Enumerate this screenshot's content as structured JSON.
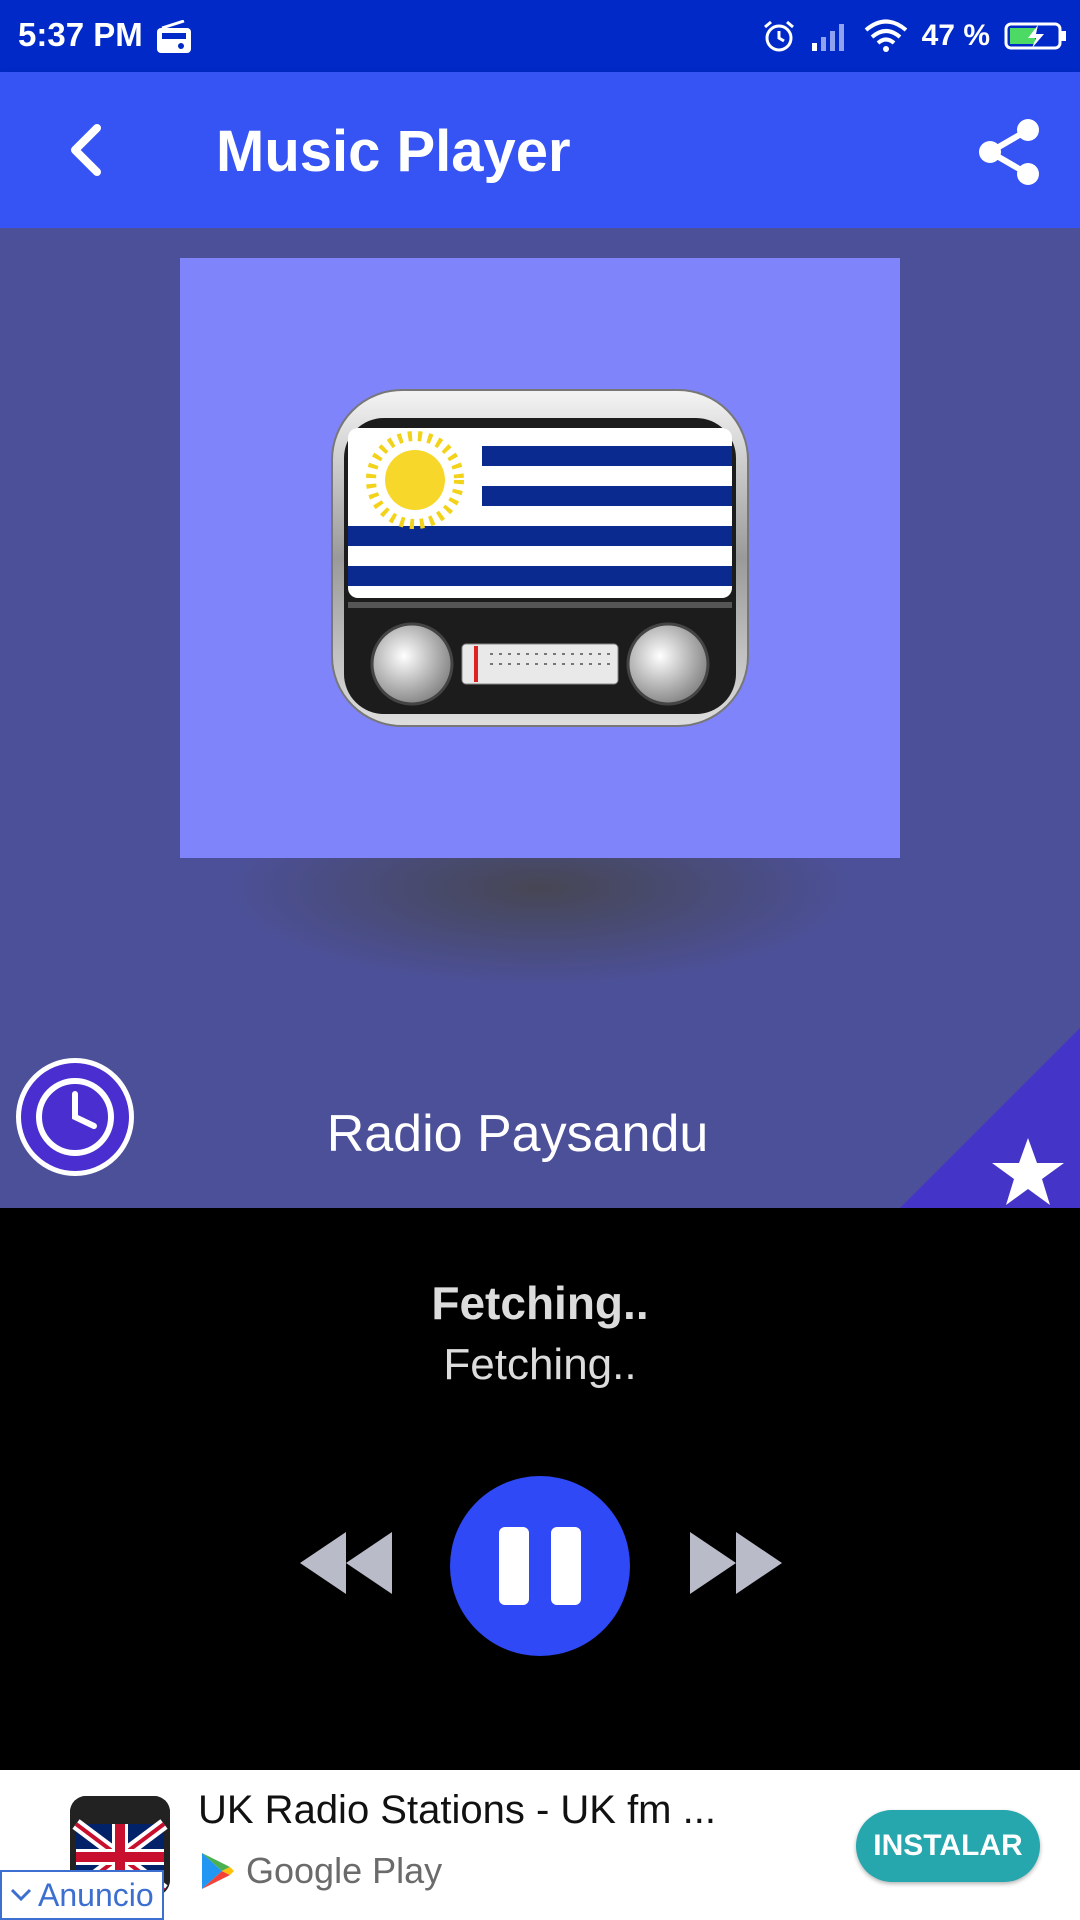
{
  "status_bar": {
    "time": "5:37 PM",
    "battery": "47 %",
    "icons": [
      "radio-icon",
      "alarm-icon",
      "signal-icon",
      "wifi-icon",
      "battery-charging-icon"
    ]
  },
  "app_bar": {
    "title": "Music Player",
    "back_icon": "chevron-left-icon",
    "share_icon": "share-icon"
  },
  "station": {
    "name": "Radio Paysandu"
  },
  "now_playing": {
    "title": "Fetching..",
    "artist": "Fetching.."
  },
  "ad": {
    "title": "UK Radio Stations - UK fm ...",
    "store": "Google Play",
    "install_label": "INSTALAR",
    "badge": "Anuncio"
  },
  "colors": {
    "status_bar": "#0029c7",
    "app_bar": "#3654f4",
    "hero_bg": "#4c5099",
    "artwork_bg": "#7f84fb",
    "accent": "#2e49f5",
    "install_button": "#26a6ad"
  }
}
